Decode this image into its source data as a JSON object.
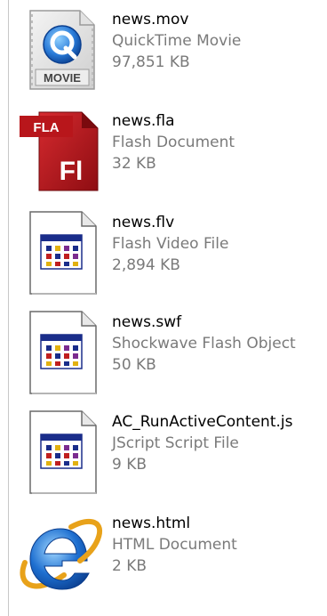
{
  "files": [
    {
      "name": "news.mov",
      "type": "QuickTime Movie",
      "size": "97,851 KB",
      "icon": "quicktime-movie-icon",
      "icon_label": "MOVIE"
    },
    {
      "name": "news.fla",
      "type": "Flash Document",
      "size": "32 KB",
      "icon": "flash-document-icon",
      "icon_label": "FLA",
      "icon_mark": "Fl"
    },
    {
      "name": "news.flv",
      "type": "Flash Video File",
      "size": "2,894 KB",
      "icon": "generic-file-icon"
    },
    {
      "name": "news.swf",
      "type": "Shockwave Flash Object",
      "size": "50 KB",
      "icon": "generic-file-icon"
    },
    {
      "name": "AC_RunActiveContent.js",
      "type": "JScript Script File",
      "size": "9 KB",
      "icon": "generic-file-icon"
    },
    {
      "name": "news.html",
      "type": "HTML Document",
      "size": "2 KB",
      "icon": "internet-explorer-icon"
    }
  ],
  "colors": {
    "name_text": "#000000",
    "detail_text": "#7a7a7a",
    "flash_red": "#b8161b",
    "ie_blue": "#1e6fd0",
    "quicktime_blue": "#2a7bd8"
  }
}
